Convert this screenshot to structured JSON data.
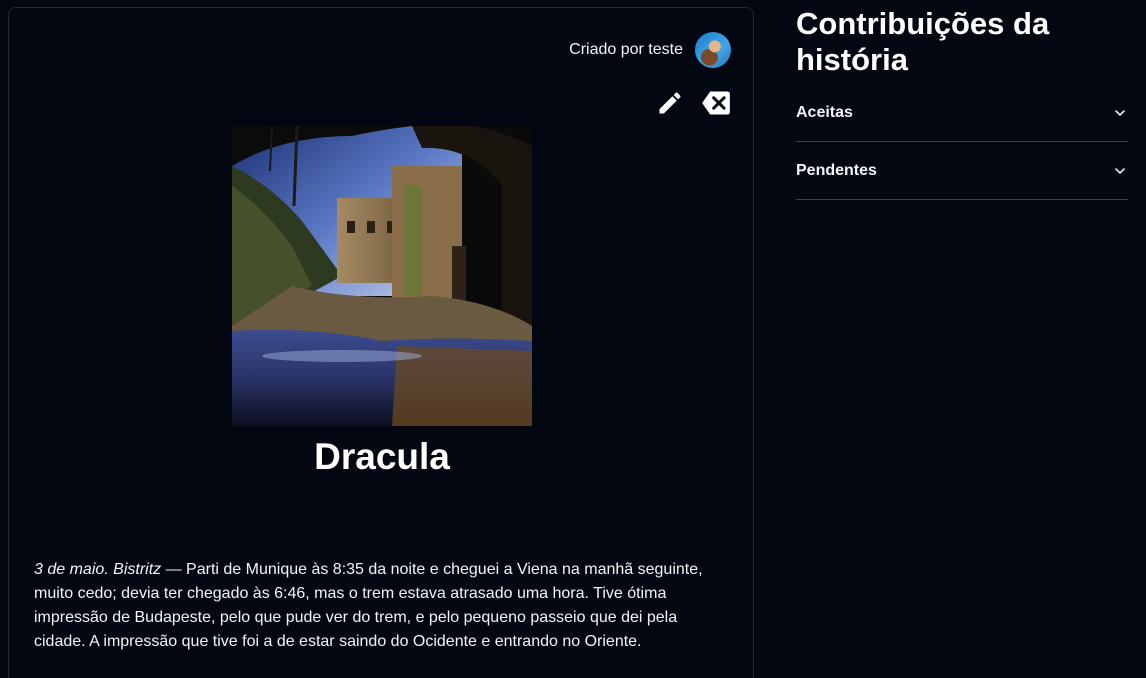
{
  "story": {
    "creator_text": "Criado por teste",
    "title": "Dracula",
    "body": {
      "date_location": "3 de maio. Bistritz",
      "dash": " — ",
      "text": "Parti de Munique às 8:35 da noite e cheguei a Viena na manhã seguinte, muito cedo; devia ter chegado às 6:46, mas o trem estava atrasado uma hora. Tive ótima impressão de Budapeste, pelo que pude ver do trem, e pelo pequeno passeio que dei pela cidade. A impressão que tive foi a de estar saindo do Ocidente e entrando no Oriente."
    },
    "icons": {
      "edit": "pencil-icon",
      "delete": "backspace-delete-icon"
    }
  },
  "sidebar": {
    "title": "Contribuições da história",
    "sections": [
      {
        "label": "Aceitas",
        "icon": "chevron-down-icon"
      },
      {
        "label": "Pendentes",
        "icon": "chevron-down-icon"
      }
    ]
  }
}
